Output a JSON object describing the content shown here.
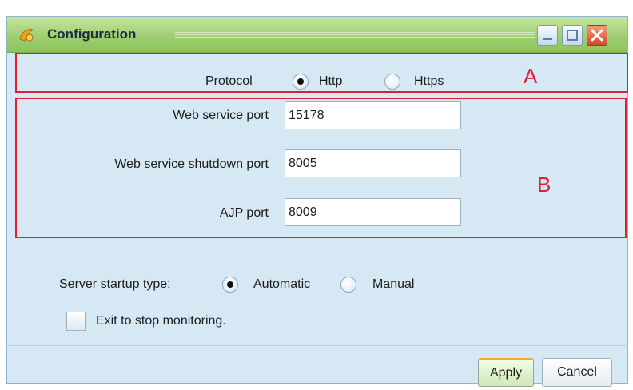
{
  "window": {
    "title": "Configuration"
  },
  "protocol": {
    "label": "Protocol",
    "options": [
      "Http",
      "Https"
    ],
    "selected": "Http"
  },
  "ports": {
    "web_service_port": {
      "label": "Web service port",
      "value": "15178"
    },
    "web_service_shutdown_port": {
      "label": "Web service shutdown port",
      "value": "8005"
    },
    "ajp_port": {
      "label": "AJP port",
      "value": "8009"
    }
  },
  "annotations": {
    "a": "A",
    "b": "B"
  },
  "startup": {
    "label": "Server startup type:",
    "options": [
      "Automatic",
      "Manual"
    ],
    "selected": "Automatic"
  },
  "exit_checkbox": {
    "label": "Exit to stop monitoring.",
    "checked": false
  },
  "buttons": {
    "apply": "Apply",
    "cancel": "Cancel"
  },
  "colors": {
    "annotation_red": "#e0202c",
    "title_bar_green": "#9fcf72",
    "window_bg": "#d5e8f4"
  },
  "icons": [
    "app-icon",
    "minimize-icon",
    "maximize-icon",
    "close-icon"
  ]
}
